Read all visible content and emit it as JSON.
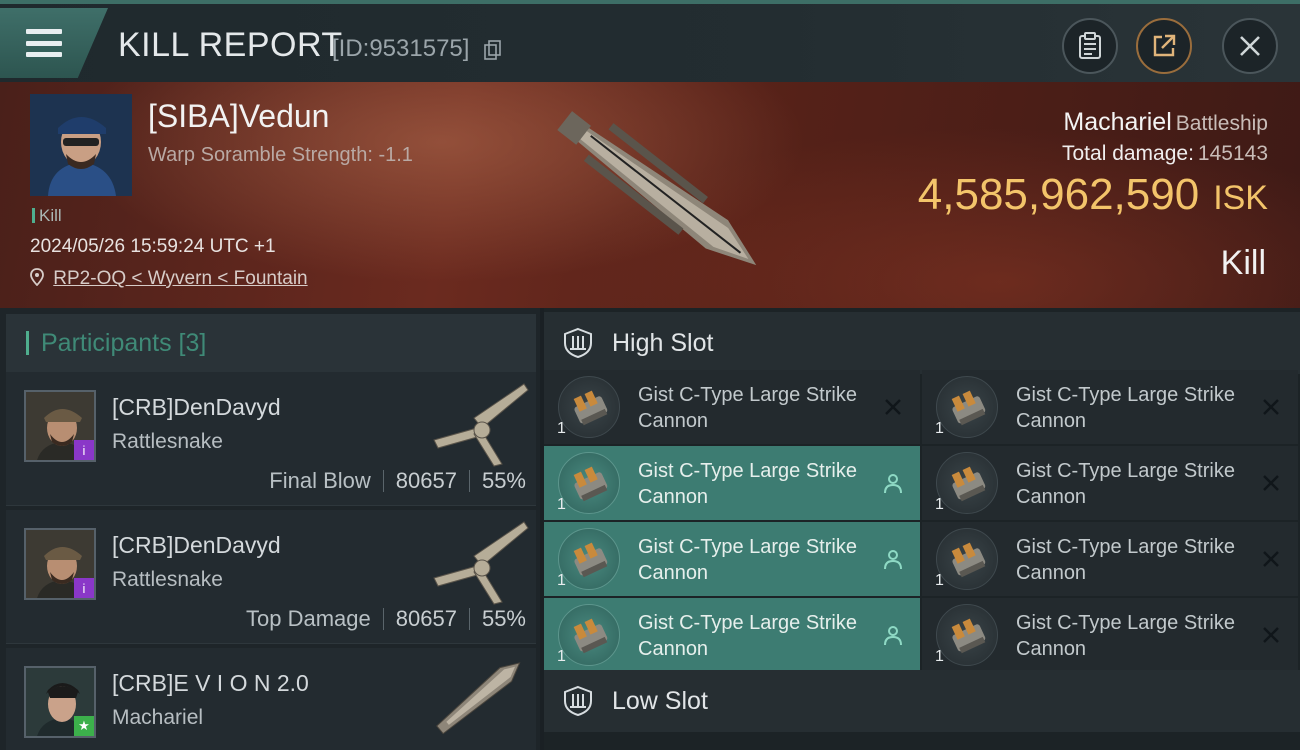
{
  "header": {
    "title": "KILL REPORT",
    "report_id": "[ID:9531575]"
  },
  "victim": {
    "name": "[SIBA]Vedun",
    "warp_scramble": "Warp Soramble Strength: -1.1",
    "kill_tag": "Kill",
    "datetime": "2024/05/26 15:59:24 UTC +1",
    "location": "RP2-OQ < Wyvern < Fountain",
    "ship_name": "Machariel",
    "ship_class": "Battleship",
    "total_damage_label": "Total damage:",
    "total_damage": "145143",
    "isk_value": "4,585,962,590",
    "isk_unit": "ISK",
    "result": "Kill"
  },
  "participants": {
    "header": "Participants [3]",
    "items": [
      {
        "name": "[CRB]DenDavyd",
        "ship": "Rattlesnake",
        "role": "Final Blow",
        "damage": "80657",
        "percent": "55%",
        "badge": "i"
      },
      {
        "name": "[CRB]DenDavyd",
        "ship": "Rattlesnake",
        "role": "Top Damage",
        "damage": "80657",
        "percent": "55%",
        "badge": "i"
      },
      {
        "name": "[CRB]E V I O N 2.0",
        "ship": "Machariel",
        "role": "",
        "damage": "",
        "percent": "",
        "badge": "★"
      }
    ]
  },
  "slots": {
    "high_label": "High Slot",
    "low_label": "Low Slot",
    "high_modules": [
      {
        "name": "Gist C-Type Large Strike Cannon",
        "qty": "1",
        "status": "destroyed"
      },
      {
        "name": "Gist C-Type Large Strike Cannon",
        "qty": "1",
        "status": "destroyed"
      },
      {
        "name": "Gist C-Type Large Strike Cannon",
        "qty": "1",
        "status": "dropped"
      },
      {
        "name": "Gist C-Type Large Strike Cannon",
        "qty": "1",
        "status": "destroyed"
      },
      {
        "name": "Gist C-Type Large Strike Cannon",
        "qty": "1",
        "status": "dropped"
      },
      {
        "name": "Gist C-Type Large Strike Cannon",
        "qty": "1",
        "status": "destroyed"
      },
      {
        "name": "Gist C-Type Large Strike Cannon",
        "qty": "1",
        "status": "dropped"
      },
      {
        "name": "Gist C-Type Large Strike Cannon",
        "qty": "1",
        "status": "destroyed"
      }
    ]
  },
  "colors": {
    "accent_teal": "#3d7c72",
    "isk_gold": "#f3c46a",
    "badge_purple": "#8a37c8",
    "badge_green": "#3cb04b"
  },
  "icons": [
    "menu-icon",
    "copy-icon",
    "clipboard-icon",
    "share-icon",
    "close-icon",
    "location-pin-icon",
    "slot-shield-icon",
    "person-icon",
    "x-icon"
  ]
}
